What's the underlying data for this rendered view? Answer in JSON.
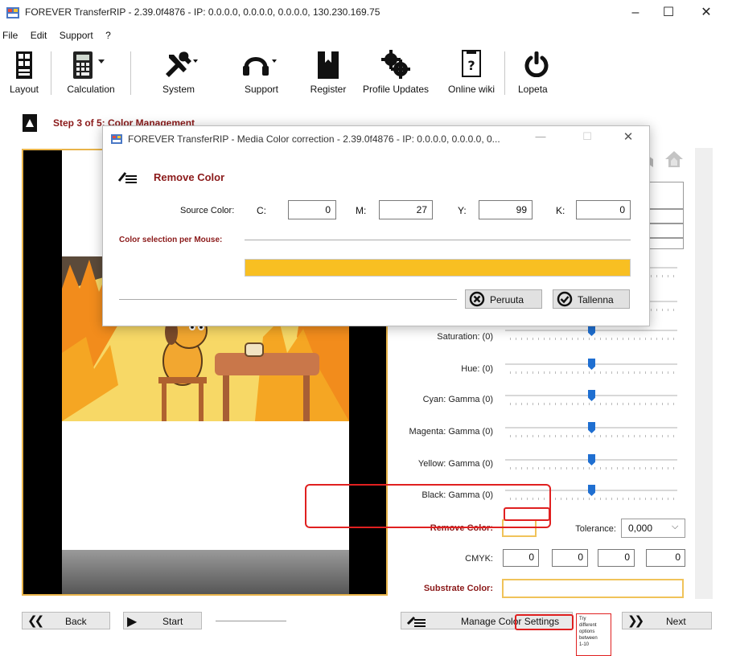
{
  "window": {
    "title": "FOREVER TransferRIP - 2.39.0f4876 - IP: 0.0.0.0, 0.0.0.0, 0.0.0.0, 130.230.169.75",
    "minimize": "–",
    "maximize": "☐",
    "close": "✕"
  },
  "menu": [
    "File",
    "Edit",
    "Support",
    "?"
  ],
  "toolbar": [
    {
      "label": "Layout",
      "icon": "layout-icon"
    },
    {
      "label": "Calculation",
      "icon": "calculator-icon"
    },
    {
      "label": "System",
      "icon": "tools-icon"
    },
    {
      "label": "Support",
      "icon": "headset-icon"
    },
    {
      "label": "Register",
      "icon": "book-icon"
    },
    {
      "label": "Profile Updates",
      "icon": "gears-icon"
    },
    {
      "label": "Online wiki",
      "icon": "help-document-icon"
    },
    {
      "label": "Lopeta",
      "icon": "power-icon"
    }
  ],
  "step": {
    "title": "Step 3 of 5: Color Management"
  },
  "adjustments": [
    {
      "label": "Saturation: (0)",
      "value": 0
    },
    {
      "label": "Hue: (0)",
      "value": 0
    },
    {
      "label": "Cyan: Gamma (0)",
      "value": 0
    },
    {
      "label": "Magenta: Gamma (0)",
      "value": 0
    },
    {
      "label": "Yellow: Gamma (0)",
      "value": 0
    },
    {
      "label": "Black: Gamma (0)",
      "value": 0
    }
  ],
  "remove_color": {
    "label": "Remove Color:",
    "tolerance_label": "Tolerance:",
    "tolerance_value": "0,000",
    "cmyk_label": "CMYK:",
    "cmyk": [
      "0",
      "0",
      "0",
      "0"
    ]
  },
  "substrate": {
    "label": "Substrate Color:"
  },
  "nav": {
    "back": "Back",
    "start": "Start",
    "manage": "Manage Color Settings",
    "next": "Next"
  },
  "annotation_note": [
    "Try",
    "different",
    "options",
    "between",
    "1-10"
  ],
  "dialog": {
    "title": "FOREVER TransferRIP - Media Color correction - 2.39.0f4876 - IP: 0.0.0.0, 0.0.0.0, 0...",
    "minimize": "—",
    "maximize": "☐",
    "close": "✕",
    "heading": "Remove Color",
    "source_color_label": "Source Color:",
    "c_label": "C:",
    "c_value": "0",
    "m_label": "M:",
    "m_value": "27",
    "y_label": "Y:",
    "y_value": "99",
    "k_label": "K:",
    "k_value": "0",
    "mouse_label": "Color selection per Mouse:",
    "swatch_color": "#f8bf22",
    "cancel": "Peruuta",
    "save": "Tallenna"
  },
  "colors": {
    "accent_dark_red": "#8b1a1a",
    "annotation_red": "#e02020",
    "highlight_orange": "#f0c35a",
    "slider_blue": "#1f6fd1"
  }
}
